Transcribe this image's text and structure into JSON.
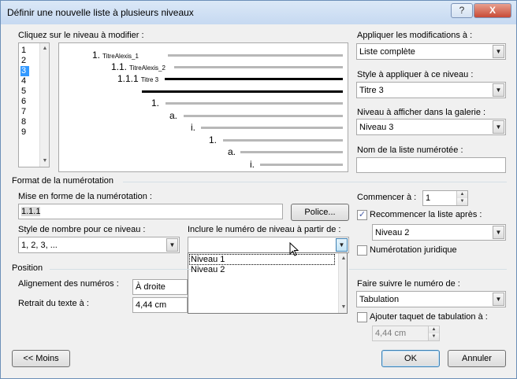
{
  "dialog": {
    "title": "Définir une nouvelle liste à plusieurs niveaux",
    "help_glyph": "?",
    "close_glyph": "X"
  },
  "level_select": {
    "label": "Cliquez sur le niveau à modifier :",
    "items": [
      "1",
      "2",
      "3",
      "4",
      "5",
      "6",
      "7",
      "8",
      "9"
    ],
    "selected": "3"
  },
  "preview": {
    "rows": [
      {
        "num": "1.",
        "style": "TitreAlexis_1"
      },
      {
        "num": "1.1.",
        "style": "TitreAlexis_2"
      },
      {
        "num": "1.1.1",
        "style": "Titre 3"
      },
      {
        "num": "1.",
        "style": ""
      },
      {
        "num": "a.",
        "style": ""
      },
      {
        "num": "i.",
        "style": ""
      },
      {
        "num": "1.",
        "style": ""
      },
      {
        "num": "a.",
        "style": ""
      },
      {
        "num": "i.",
        "style": ""
      }
    ]
  },
  "apply_changes": {
    "label": "Appliquer les modifications à :",
    "value": "Liste complète"
  },
  "style_level": {
    "label": "Style à appliquer à ce niveau :",
    "value": "Titre 3"
  },
  "gallery_level": {
    "label": "Niveau à afficher dans la galerie :",
    "value": "Niveau 3"
  },
  "list_name": {
    "label": "Nom de la liste numérotée :",
    "value": ""
  },
  "numbering_format": {
    "section": "Format de la numérotation",
    "format_label": "Mise en forme de la numérotation :",
    "format_value": "1.1.1",
    "font_button": "Police...",
    "number_style_label": "Style de nombre pour ce niveau :",
    "number_style_value": "1, 2, 3, ...",
    "include_level_label": "Inclure le numéro de niveau à partir de :",
    "include_level_value": "",
    "include_level_options": [
      "Niveau 1",
      "Niveau 2"
    ]
  },
  "start_at": {
    "label": "Commencer à :",
    "value": "1"
  },
  "restart": {
    "label": "Recommencer la liste après :",
    "checked": true,
    "value": "Niveau 2"
  },
  "legal": {
    "label": "Numérotation juridique",
    "checked": false
  },
  "position": {
    "section": "Position",
    "align_label": "Alignement des numéros :",
    "align_value": "À droite",
    "indent_label": "Retrait du texte à :",
    "indent_value": "4,44 cm",
    "follow_label": "Faire suivre le numéro de :",
    "follow_value": "Tabulation",
    "tab_stop_label": "Ajouter taquet de tabulation à :",
    "tab_stop_checked": false,
    "tab_stop_value": "4,44 cm"
  },
  "footer": {
    "less_button": "<< Moins",
    "ok_button": "OK",
    "cancel_button": "Annuler"
  }
}
